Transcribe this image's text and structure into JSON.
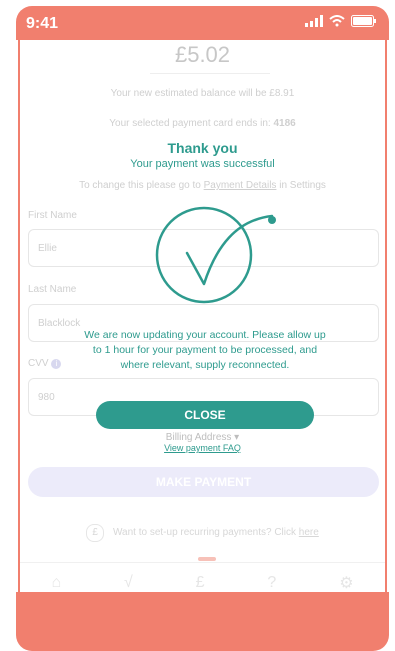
{
  "status_bar": {
    "time": "9:41"
  },
  "payment": {
    "amount": "£5.02",
    "balance_text": "Your new estimated balance will be £8.91",
    "card_text": "Your selected payment card ends in:",
    "card_last4": "4186",
    "change_text": "To change this please go to",
    "change_link": "Payment Details",
    "change_suffix": "in Settings",
    "first_name_label": "First Name",
    "first_name_value": "Ellie",
    "last_name_label": "Last Name",
    "last_name_value": "Blacklock",
    "cvv_label": "CVV",
    "cvv_value": "980",
    "make_payment": "MAKE PAYMENT",
    "recurring_text": "Want to set-up recurring payments? Click",
    "recurring_link": "here"
  },
  "modal": {
    "title": "Thank you",
    "subtitle": "Your payment was successful",
    "message": "We are now updating your account. Please allow up to 1 hour for your payment to be processed, and where relevant, supply reconnected.",
    "close_label": "CLOSE",
    "billing_label": "Billing Address",
    "faq_link": "View payment FAQ"
  },
  "tabbar": {
    "icons": [
      "home-icon",
      "check-icon",
      "pound-icon",
      "help-icon",
      "settings-icon"
    ]
  },
  "colors": {
    "brand": "#F17F6E",
    "accent": "#2E9B8E"
  }
}
